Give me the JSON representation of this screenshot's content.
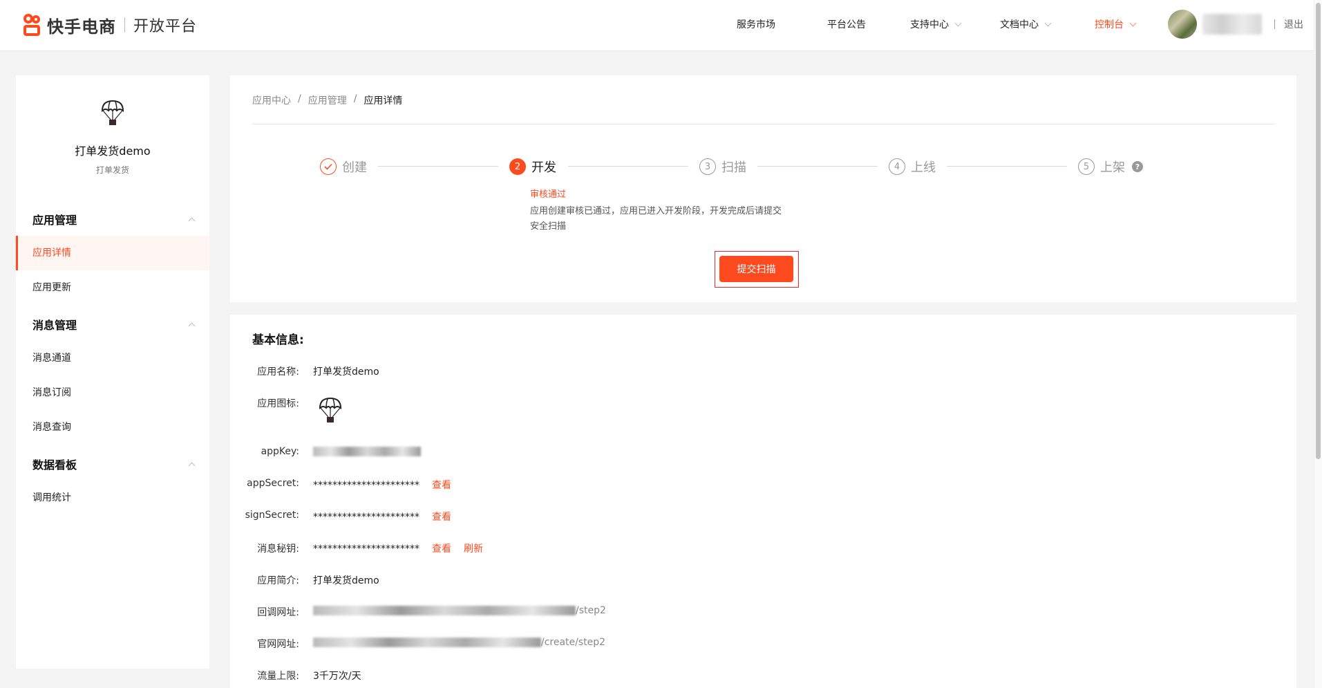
{
  "header": {
    "logo_text": "快手电商",
    "logo_sub": "开放平台",
    "nav": [
      {
        "label": "服务市场",
        "dropdown": false,
        "active": false
      },
      {
        "label": "平台公告",
        "dropdown": false,
        "active": false
      },
      {
        "label": "支持中心",
        "dropdown": true,
        "active": false
      },
      {
        "label": "文档中心",
        "dropdown": true,
        "active": false
      },
      {
        "label": "控制台",
        "dropdown": true,
        "active": true
      }
    ],
    "logout": "退出"
  },
  "sidebar": {
    "app_name": "打单发货demo",
    "app_sub": "打单发货",
    "groups": [
      {
        "title": "应用管理",
        "items": [
          {
            "label": "应用详情",
            "active": true
          },
          {
            "label": "应用更新",
            "active": false
          }
        ]
      },
      {
        "title": "消息管理",
        "items": [
          {
            "label": "消息通道",
            "active": false
          },
          {
            "label": "消息订阅",
            "active": false
          },
          {
            "label": "消息查询",
            "active": false
          }
        ]
      },
      {
        "title": "数据看板",
        "items": [
          {
            "label": "调用统计",
            "active": false
          }
        ]
      }
    ]
  },
  "breadcrumb": [
    "应用中心",
    "应用管理",
    "应用详情"
  ],
  "steps": [
    {
      "num": "1",
      "label": "创建",
      "state": "done"
    },
    {
      "num": "2",
      "label": "开发",
      "state": "current"
    },
    {
      "num": "3",
      "label": "扫描",
      "state": "todo"
    },
    {
      "num": "4",
      "label": "上线",
      "state": "todo"
    },
    {
      "num": "5",
      "label": "上架",
      "state": "todo"
    }
  ],
  "status": {
    "title": "审核通过",
    "desc": "应用创建审核已通过，应用已进入开发阶段，开发完成后请提交安全扫描"
  },
  "submit_label": "提交扫描",
  "basic_info": {
    "title": "基本信息:",
    "rows": {
      "name": {
        "label": "应用名称:",
        "value": "打单发货demo"
      },
      "icon": {
        "label": "应用图标:"
      },
      "appkey": {
        "label": "appKey:"
      },
      "appsecret": {
        "label": "appSecret:",
        "value": "**********************",
        "link": "查看"
      },
      "signsecret": {
        "label": "signSecret:",
        "value": "**********************",
        "link": "查看"
      },
      "msgsecret": {
        "label": "消息秘钥:",
        "value": "**********************",
        "link": "查看",
        "link2": "刷新"
      },
      "intro": {
        "label": "应用简介:",
        "value": "打单发货demo"
      },
      "callback": {
        "label": "回调网址:",
        "visible_suffix": "/step2"
      },
      "website": {
        "label": "官网网址:",
        "visible_suffix": "/create/step2"
      },
      "limit": {
        "label": "流量上限:",
        "value": "3千万次/天"
      }
    }
  },
  "colors": {
    "accent": "#fe4a1f",
    "bg": "#f4f4f4"
  }
}
